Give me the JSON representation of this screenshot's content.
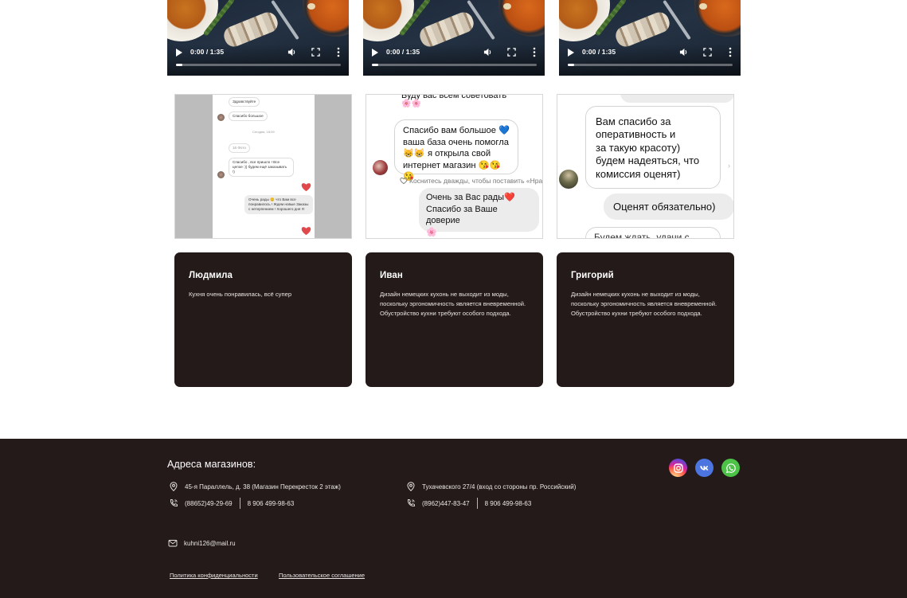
{
  "videos": [
    {
      "time": "0:00 / 1:35",
      "progress": 0.04
    },
    {
      "time": "0:00 / 1:35",
      "progress": 0.04
    },
    {
      "time": "0:00 / 1:35",
      "progress": 0.04
    }
  ],
  "screenshots": {
    "shot1": {
      "msg1": "Здравствуйте",
      "msg2": "Спасибо большое",
      "date": "Сегодня, 18:09",
      "photos": "16 Фото",
      "msg3": "Спасибо , все пришло ! Все целое :)) будем ещё заказывать !)",
      "msg4": "Очень рады 😊 что Вам все понравилось ! Ждем новые Заказы с нетерпением ! Хорошего дня !!!"
    },
    "shot2": {
      "top_line": "Буду вас всем советовать",
      "top_emoji": "🌸🌸",
      "msg_out": [
        "Спасибо вам большое 💙",
        "ваша база очень  помогла",
        "😸😸 я открыла свой",
        "интернет магазин 😘😘😘"
      ],
      "hint": "Коснитесь дважды, чтобы поставить «Нрави",
      "msg_in": [
        "Очень за Вас рады❤️",
        "Спасибо за Ваше доверие",
        "🌸"
      ]
    },
    "shot3": {
      "msg_out": [
        "Вам спасибо за",
        "оперативность и",
        "за такую красоту)",
        "будем надеяться, что",
        "комиссия оценят)"
      ],
      "msg_in": "Оценят обязательно)",
      "bottom_line": "Будем ждать, удачи с"
    }
  },
  "reviews": [
    {
      "name": "Людмила",
      "text": "Кухня очень понравилась, всё супер"
    },
    {
      "name": "Иван",
      "text": "Дизайн немецких кухонь не выходит из моды, поскольку эргономичность является вневременной. Обустройство кухни требуют особого подхода."
    },
    {
      "name": "Григорий",
      "text": "Дизайн немецких кухонь не выходит из моды, поскольку эргономичность является вневременной. Обустройство кухни требуют особого подхода."
    }
  ],
  "footer": {
    "title": "Адреса магазинов:",
    "store1": {
      "address": "45-я Параллель, д. 38 (Магазин Перекресток 2 этаж)",
      "phone1": "(88652)49-29-69",
      "phone2": "8 906 499-98-63"
    },
    "store2": {
      "address": "Тухачевского 27/4 (вход со стороны пр. Российский)",
      "phone1": "(8962)447-83-47",
      "phone2": "8 906 499-98-63"
    },
    "email": "kuhni126@mail.ru",
    "privacy_link": "Политика конфиденциальности",
    "agreement_link": "Пользовательское соглашение",
    "social": [
      {
        "icon": "instagram-icon",
        "color": "#d6249f"
      },
      {
        "icon": "vk-icon",
        "color": "#4c75e0"
      },
      {
        "icon": "whatsapp-icon",
        "color": "#4cc247"
      }
    ]
  }
}
